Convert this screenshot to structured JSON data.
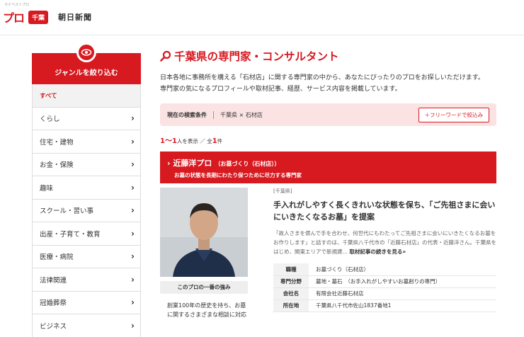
{
  "header": {
    "tiny_label": "マイベストプロ",
    "logo_text": "プロ",
    "prefecture_badge": "千葉",
    "newspaper": "朝日新聞"
  },
  "sidebar": {
    "title": "ジャンルを絞り込む",
    "items": [
      {
        "label": "すべて",
        "active": true
      },
      {
        "label": "くらし"
      },
      {
        "label": "住宅・建物"
      },
      {
        "label": "お金・保険"
      },
      {
        "label": "趣味"
      },
      {
        "label": "スクール・習い事"
      },
      {
        "label": "出産・子育て・教育"
      },
      {
        "label": "医療・病院"
      },
      {
        "label": "法律関連"
      },
      {
        "label": "冠婚葬祭"
      },
      {
        "label": "ビジネス"
      }
    ]
  },
  "main": {
    "title": "千葉県の専門家・コンサルタント",
    "intro_line1": "日本各地に事務所を構える「石材店」に関する専門家の中から、あなたにぴったりのプロをお探しいただけます。",
    "intro_line2": "専門家の気になるプロフィールや取材記事、経歴、サービス内容を掲載しています。",
    "filter": {
      "label": "現在の検索条件",
      "value": "千葉県 × 石材店",
      "button": "＋フリーワードで絞込み"
    },
    "count": {
      "range": "1〜1",
      "shown_suffix": "人を表示 ／ 全",
      "total": "1",
      "total_suffix": "件"
    },
    "pro": {
      "name": "近藤洋プロ",
      "specialty": "（お墓づくり（石材店））",
      "catchphrase": "お墓の状態を長期にわたり保つために尽力する専門家",
      "photo_caption": "このプロの一番の強み",
      "strength": "創業100年の歴史を持ち、お墓に関するさまざまな相談に対応",
      "region": "[千葉県]",
      "headline": "手入れがしやすく長くきれいな状態を保ち、「ご先祖さまに会いにいきたくなるお墓」を提案",
      "quote": "「故人さまを偲んで手を合わせ、何世代にもわたってご先祖さまに会いにいきたくなるお墓をお作りします」と話すのは、千葉県八千代市の「近藤石材店」の代表・近藤洋さん。千葉県をはじめ、関東エリアで新規建…",
      "more_link": "取材記事の続きを見る»",
      "info": [
        {
          "key": "職種",
          "value": "お墓づくり（石材店）"
        },
        {
          "key": "専門分野",
          "value": "墓地・墓石　（お手入れがしやすいお墓創りの専門）"
        },
        {
          "key": "会社名",
          "value": "有限会社近藤石材店"
        },
        {
          "key": "所在地",
          "value": "千葉県八千代市佐山1837番地1"
        }
      ]
    }
  },
  "colors": {
    "brand": "#d71920",
    "filter_bg": "#fbe3e4"
  }
}
